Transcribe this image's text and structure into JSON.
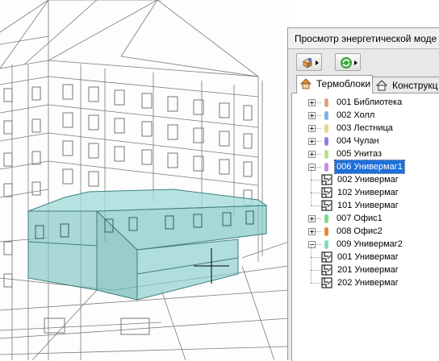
{
  "panel": {
    "title": "Просмотр энергетической моде",
    "tabs": [
      {
        "label": "Термоблоки",
        "icon": "house-icon",
        "active": true
      },
      {
        "label": "Конструкц",
        "icon": "house-icon",
        "active": false
      }
    ],
    "toolbar": [
      {
        "name": "zones-button",
        "icon": "blocks-icon"
      },
      {
        "name": "refresh-button",
        "icon": "refresh-icon"
      }
    ]
  },
  "tree": [
    {
      "label": "001 Библиотека",
      "color": "#e2a282",
      "expanded": false
    },
    {
      "label": "002 Холл",
      "color": "#7fb0e8",
      "expanded": false
    },
    {
      "label": "003 Лестница",
      "color": "#e3d88c",
      "expanded": false
    },
    {
      "label": "004 Чулан",
      "color": "#9a7fe0",
      "expanded": false
    },
    {
      "label": "005 Унитаз",
      "color": "#b5e28a",
      "expanded": false
    },
    {
      "label": "006 Универмаг1",
      "color": "#c98be4",
      "expanded": true,
      "selected": true,
      "children": [
        "002 Универмаг",
        "102 Универмаг",
        "101 Универмаг"
      ]
    },
    {
      "label": "007 Офис1",
      "color": "#7ed98a",
      "expanded": false
    },
    {
      "label": "008 Офис2",
      "color": "#e08c3a",
      "expanded": false
    },
    {
      "label": "009 Универмаг2",
      "color": "#7fdcc6",
      "expanded": true,
      "children": [
        "001 Универмаг",
        "201 Универмаг",
        "202 Универмаг"
      ]
    }
  ]
}
